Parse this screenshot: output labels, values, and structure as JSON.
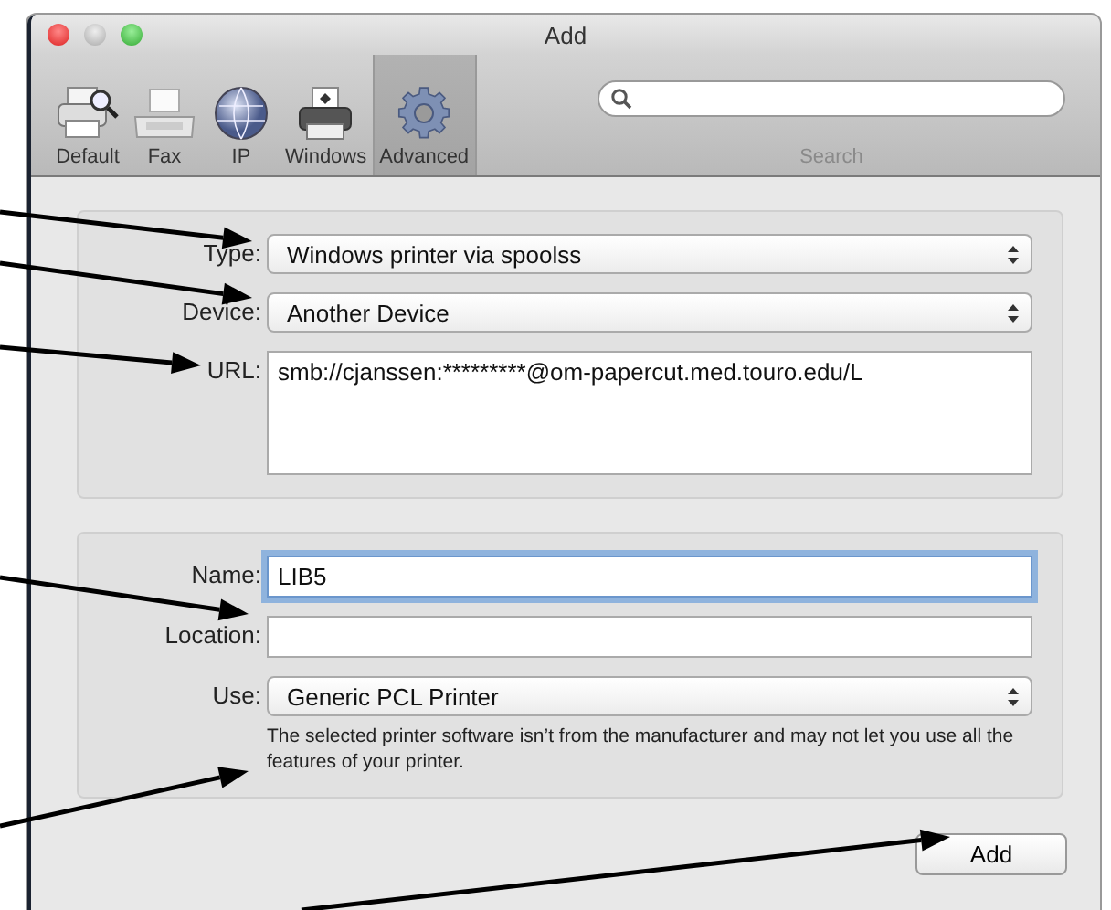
{
  "window": {
    "title": "Add"
  },
  "toolbar": {
    "items": [
      {
        "kind": "default",
        "label": "Default",
        "selected": false
      },
      {
        "kind": "fax",
        "label": "Fax",
        "selected": false
      },
      {
        "kind": "ip",
        "label": "IP",
        "selected": false
      },
      {
        "kind": "windows",
        "label": "Windows",
        "selected": false
      },
      {
        "kind": "advanced",
        "label": "Advanced",
        "selected": true
      }
    ],
    "search": {
      "label": "Search"
    }
  },
  "connection": {
    "fields": [
      {
        "kind": "popup",
        "label": "Type:",
        "value": "Windows printer via spoolss"
      },
      {
        "kind": "popup",
        "label": "Device:",
        "value": "Another Device"
      },
      {
        "kind": "textarea",
        "label": "URL:",
        "value": "smb://cjanssen:*********@om-papercut.med.touro.edu/L"
      }
    ]
  },
  "printer": {
    "fields": [
      {
        "kind": "text",
        "label": "Name:",
        "value": "LIB5",
        "focused": true
      },
      {
        "kind": "text",
        "label": "Location:",
        "focused": false
      },
      {
        "kind": "popup",
        "label": "Use:",
        "value": "Generic PCL Printer"
      }
    ],
    "note": "The selected printer software isn’t from the manufacturer and may not let you use all the features of your printer."
  },
  "buttons": [
    {
      "label": "Add"
    }
  ]
}
